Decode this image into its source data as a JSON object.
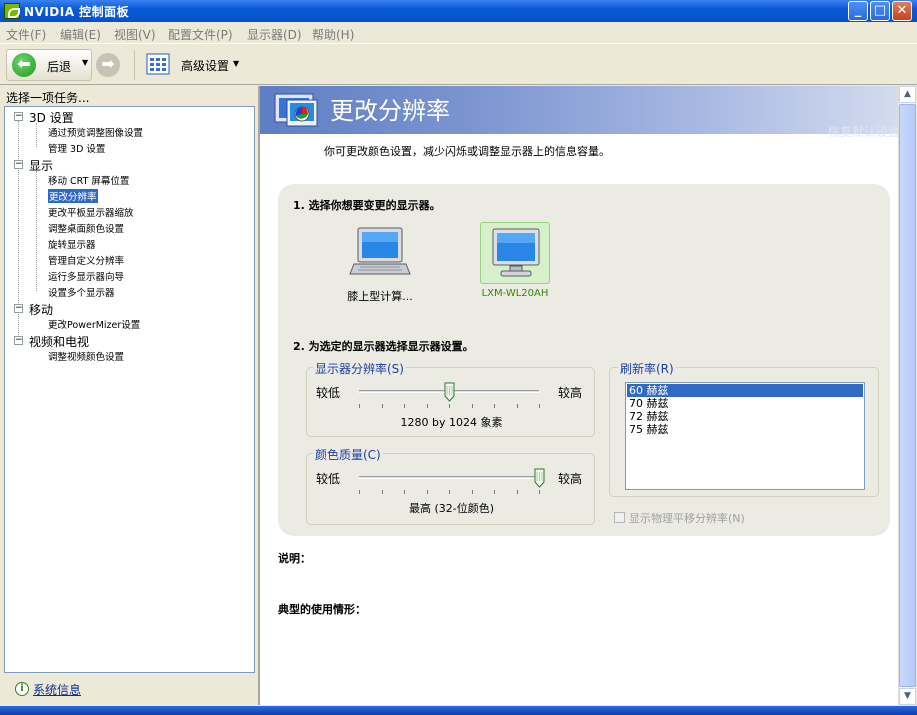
{
  "window": {
    "title": "NVIDIA 控制面板"
  },
  "menu": [
    "文件(F)",
    "编辑(E)",
    "视图(V)",
    "配置文件(P)",
    "显示器(D)",
    "帮助(H)"
  ],
  "toolbar": {
    "back_label": "后退",
    "advanced_label": "高级设置"
  },
  "left": {
    "header": "选择一项任务...",
    "groups": [
      {
        "label": "3D 设置",
        "items": [
          "通过预览调整图像设置",
          "管理 3D 设置"
        ]
      },
      {
        "label": "显示",
        "items": [
          "移动 CRT 屏幕位置",
          "更改分辨率",
          "更改平板显示器缩放",
          "调整桌面颜色设置",
          "旋转显示器",
          "管理自定义分辨率",
          "运行多显示器向导",
          "设置多个显示器"
        ]
      },
      {
        "label": "移动",
        "items": [
          "更改PowerMizer设置"
        ]
      },
      {
        "label": "视频和电视",
        "items": [
          "调整视频颜色设置"
        ]
      }
    ],
    "selected_item": "更改分辨率",
    "system_info": "系统信息"
  },
  "page": {
    "title": "更改分辨率",
    "restore_defaults": "恢复默认设置",
    "description": "你可更改颜色设置，减少闪烁或调整显示器上的信息容量。",
    "step1": "1.  选择你想要变更的显示器。",
    "monitors": [
      {
        "label": "膝上型计算...",
        "selected": false
      },
      {
        "label": "LXM-WL20AH",
        "selected": true
      }
    ],
    "step2": "2.  为选定的显示器选择显示器设置。",
    "resolution": {
      "legend": "显示器分辨率(S)",
      "low": "较低",
      "high": "较高",
      "value_text": "1280 by 1024 象素",
      "level": 0.5
    },
    "color": {
      "legend": "颜色质量(C)",
      "low": "较低",
      "high": "较高",
      "value_text": "最高 (32-位颜色)",
      "level": 1.0
    },
    "refresh": {
      "legend": "刷新率(R)",
      "options": [
        "60 赫兹",
        "70 赫兹",
        "72 赫兹",
        "75 赫兹"
      ],
      "selected": "60 赫兹"
    },
    "physical_panning": "显示物理平移分辨率(N)",
    "explain_label": "说明：",
    "usage_label": "典型的使用情形："
  },
  "colors": {
    "title_bar": "#0a5ad8",
    "banner": "#5e7ec4",
    "selection": "#316ac5",
    "accent_text": "#1f3fa3",
    "monitor_green": "#2e8b00"
  }
}
